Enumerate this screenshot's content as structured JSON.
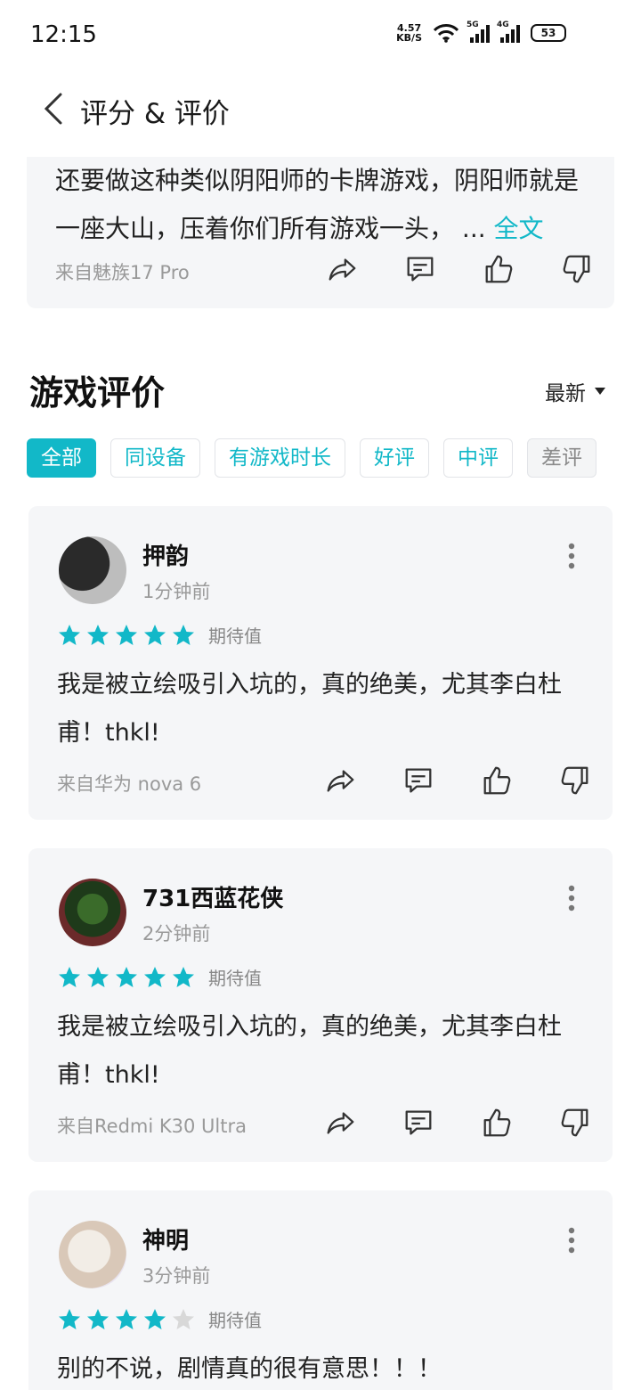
{
  "status": {
    "time": "12:15",
    "net_speed_top": "4.57",
    "net_speed_bottom": "KB/S",
    "sig1_label": "5G",
    "sig2_label": "4G",
    "battery": "53"
  },
  "header": {
    "title": "评分 & 评价"
  },
  "top_review": {
    "text": "还要做这种类似阴阳师的卡牌游戏，阴阳师就是一座大山，压着你们所有游戏一头，",
    "ellipsis": " ... ",
    "more": "全文",
    "device": "来自魅族17 Pro"
  },
  "section": {
    "title": "游戏评价",
    "sort_label": "最新"
  },
  "filters": [
    {
      "label": "全部",
      "state": "active"
    },
    {
      "label": "同设备",
      "state": "normal"
    },
    {
      "label": "有游戏时长",
      "state": "normal"
    },
    {
      "label": "好评",
      "state": "normal"
    },
    {
      "label": "中评",
      "state": "normal"
    },
    {
      "label": "差评",
      "state": "grey"
    }
  ],
  "reviews": [
    {
      "name": "押韵",
      "time": "1分钟前",
      "stars": 5,
      "rating_label": "期待值",
      "text": "我是被立绘吸引入坑的，真的绝美，尤其李白杜甫！thkl!",
      "device": "来自华为 nova 6"
    },
    {
      "name": "731西蓝花侠",
      "time": "2分钟前",
      "stars": 5,
      "rating_label": "期待值",
      "text": "我是被立绘吸引入坑的，真的绝美，尤其李白杜甫！thkl!",
      "device": "来自Redmi K30 Ultra"
    },
    {
      "name": "神明",
      "time": "3分钟前",
      "stars": 4,
      "rating_label": "期待值",
      "text": "别的不说，剧情真的很有意思！！！"
    }
  ],
  "colors": {
    "accent": "#12b8c8",
    "card_bg": "#f5f6f8",
    "star_empty": "#d8d8d8"
  },
  "icons": {
    "share": "share-icon",
    "comment": "comment-icon",
    "like": "thumbs-up-icon",
    "dislike": "thumbs-down-icon",
    "more": "more-vertical-icon",
    "back": "chevron-left-icon"
  }
}
